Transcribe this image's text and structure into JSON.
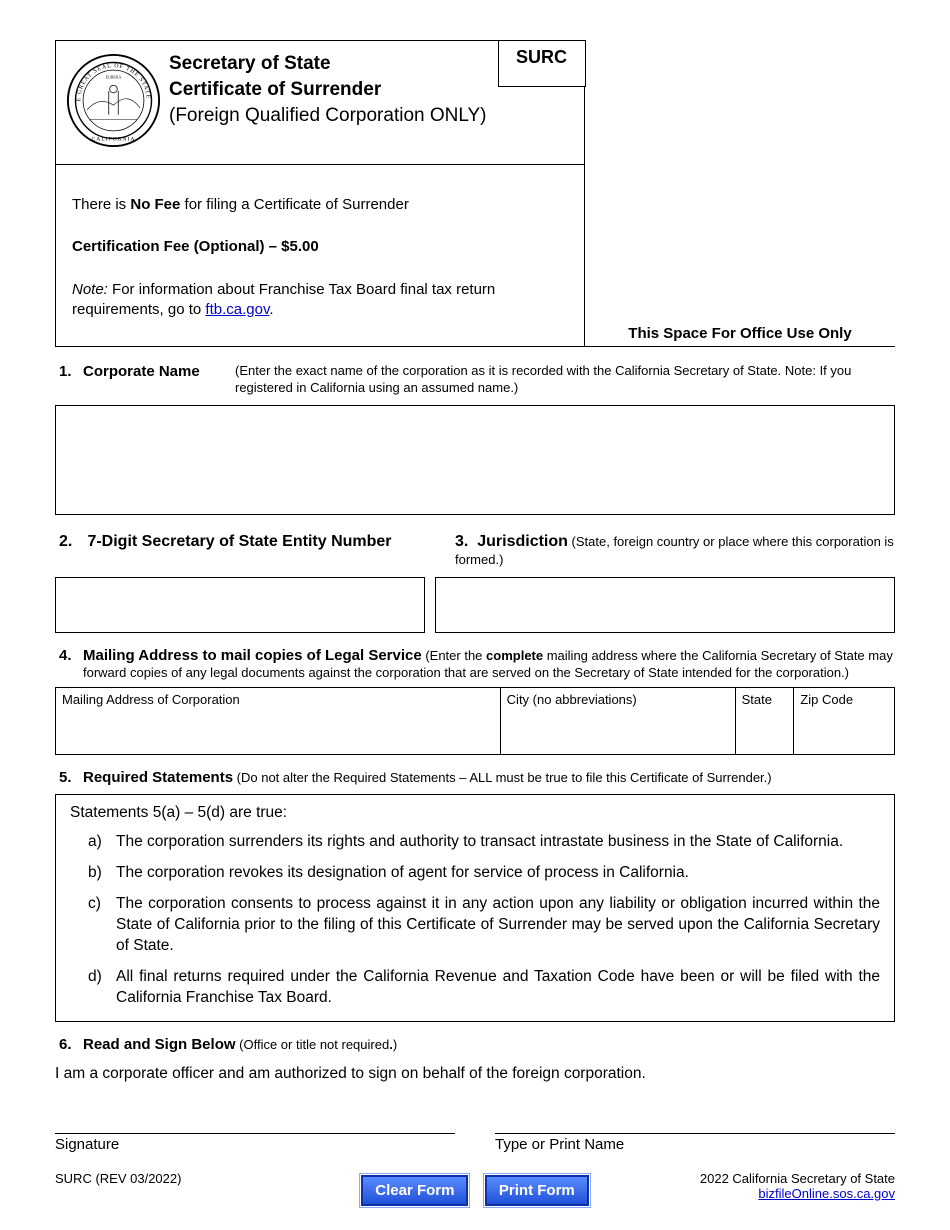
{
  "header": {
    "line1": "Secretary of State",
    "line2": "Certificate of Surrender",
    "line3": "(Foreign Qualified Corporation ONLY)",
    "form_code": "SURC"
  },
  "fee_box": {
    "no_fee_prefix": "There is ",
    "no_fee_bold": "No Fee",
    "no_fee_suffix": " for filing a Certificate of Surrender",
    "cert_fee_label": "Certification Fee (Optional)  –   $5.00",
    "note_prefix": "Note:",
    "note_text": " For information about Franchise Tax Board final tax return requirements, go to ",
    "note_link": "ftb.ca.gov",
    "note_period": "."
  },
  "office_use": "This Space For Office Use Only",
  "s1": {
    "num": "1.",
    "title": "Corporate Name",
    "paren": "(Enter the exact name of the corporation as it is recorded with the California Secretary of State.   Note:  If you registered in California using an assumed name.)"
  },
  "s2": {
    "num": "2.",
    "title": "7-Digit Secretary of State Entity Number"
  },
  "s3": {
    "num": "3.",
    "title": "Jurisdiction",
    "paren": " (State, foreign country or place where this corporation is formed.)"
  },
  "s4": {
    "num": "4.",
    "title": "Mailing Address to mail copies of Legal Service",
    "paren_prefix": " (Enter the ",
    "paren_bold": "complete",
    "paren_suffix": " mailing address where the California Secretary of State may forward copies of any legal documents against the corporation that are served on the Secretary of State intended for the corporation.)",
    "cols": {
      "c1": "Mailing Address of Corporation",
      "c2": "City (no abbreviations)",
      "c3": "State",
      "c4": "Zip Code"
    }
  },
  "s5": {
    "num": "5.",
    "title": "Required Statements",
    "paren": " (Do not alter the Required Statements – ALL must be true to file this Certificate of Surrender.)",
    "intro": "Statements 5(a) – 5(d) are true:",
    "items": [
      {
        "letter": "a)",
        "text": "The corporation surrenders its rights and authority to transact intrastate business in the State of California."
      },
      {
        "letter": "b)",
        "text": "The corporation revokes its designation of agent for service of process in California."
      },
      {
        "letter": "c)",
        "text": "The corporation consents to process against it in any action upon any liability or obligation incurred within the State of California prior to the filing of this Certificate of Surrender may be served upon the California Secretary of State."
      },
      {
        "letter": "d)",
        "text": "All final returns required under the California Revenue and Taxation Code have been or will be filed with the California Franchise Tax Board."
      }
    ]
  },
  "s6": {
    "num": "6.",
    "title": "Read and Sign Below",
    "paren": " (Office or title not required",
    "paren_bold_period": ".",
    "paren_close": ")",
    "declaration": "I am a corporate officer and am authorized to sign on behalf of the foreign corporation.",
    "sig_label": "Signature",
    "name_label": "Type or Print Name"
  },
  "footer": {
    "left": "SURC (REV 03/2022)",
    "right1": "2022 California Secretary of State",
    "right2": "bizfileOnline.sos.ca.gov"
  },
  "buttons": {
    "clear": "Clear Form",
    "print": "Print Form"
  }
}
